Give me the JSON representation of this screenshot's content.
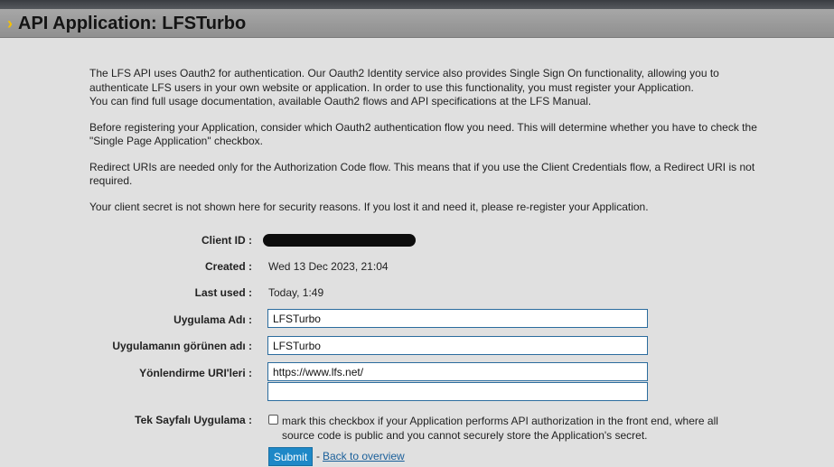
{
  "header": {
    "title": "API Application: LFSTurbo",
    "chevron": "›"
  },
  "intro": {
    "p1_line1": "The LFS API uses Oauth2 for authentication. Our Oauth2 Identity service also provides Single Sign On functionality, allowing you to",
    "p1_line2": "authenticate LFS users in your own website or application. In order to use this functionality, you must register your Application.",
    "p1_line3": "You can find full usage documentation, available Oauth2 flows and API specifications at the LFS Manual.",
    "p2": "Before registering your Application, consider which Oauth2 authentication flow you need. This will determine whether you have to check the \"Single Page Application\" checkbox.",
    "p3": "Redirect URIs are needed only for the Authorization Code flow. This means that if you use the Client Credentials flow, a Redirect URI is not required.",
    "p4": "Your client secret is not shown here for security reasons. If you lost it and need it, please re-register your Application."
  },
  "form": {
    "client_id_label": "Client ID :",
    "created_label": "Created :",
    "created_value": "Wed 13 Dec 2023, 21:04",
    "last_used_label": "Last used :",
    "last_used_value": "Today, 1:49",
    "app_name_label": "Uygulama Adı :",
    "app_name_value": "LFSTurbo",
    "display_name_label": "Uygulamanın görünen adı :",
    "display_name_value": "LFSTurbo",
    "redirect_label": "Yönlendirme URI'leri :",
    "redirect_uri_1": "https://www.lfs.net/",
    "redirect_uri_2": "",
    "spa_label": "Tek Sayfalı Uygulama :",
    "spa_checked": false,
    "spa_text": "mark this checkbox if your Application performs API authorization in the front end, where all source code is public and you cannot securely store the Application's secret.",
    "submit_label": "Submit",
    "separator": "-",
    "back_link_label": "Back to overview"
  },
  "colors": {
    "accent": "#1e88c7",
    "chevron": "#f6c100",
    "link": "#1a5f9a",
    "input_border": "#2b6c9e"
  }
}
